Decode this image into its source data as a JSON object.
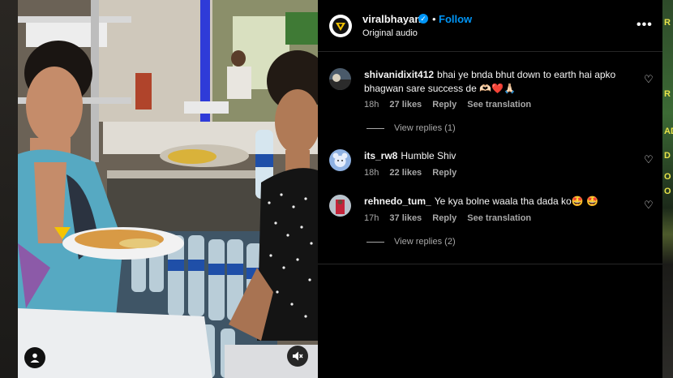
{
  "post": {
    "username": "viralbhayani",
    "verified_icon": "check-icon",
    "separator": "•",
    "follow_label": "Follow",
    "audio_label": "Original audio",
    "more_icon": "more-horizontal-icon",
    "more_glyph": "•••"
  },
  "comments": [
    {
      "username": "shivanidixit412",
      "text": "bhai ye bnda bhut down to earth hai apko bhagwan sare success de 🫶🏻❤️🙏🏻",
      "time": "18h",
      "likes": "27 likes",
      "reply": "Reply",
      "translate": "See translation",
      "view_replies": "View replies (1)"
    },
    {
      "username": "its_rw8",
      "text": "Humble Shiv",
      "time": "18h",
      "likes": "22 likes",
      "reply": "Reply"
    },
    {
      "username": "rehnedo_tum_",
      "text": "Ye kya bolne waala tha dada ko🤩 🤩",
      "time": "17h",
      "likes": "37 likes",
      "reply": "Reply",
      "translate": "See translation",
      "view_replies": "View replies (2)"
    }
  ],
  "icons": {
    "heart": "♡",
    "mute": "🔇",
    "profile": "👤"
  },
  "colors": {
    "accent": "#0095f6",
    "panel_bg": "#000000",
    "secondary_text": "#a8a8a8",
    "right_edge_text": "#e8e34a"
  },
  "right_edge": {
    "strip_1": "R",
    "strip_2": "R",
    "strip_3": "AD",
    "strip_4": "D",
    "strip_5": "O",
    "strip_6": "O"
  }
}
